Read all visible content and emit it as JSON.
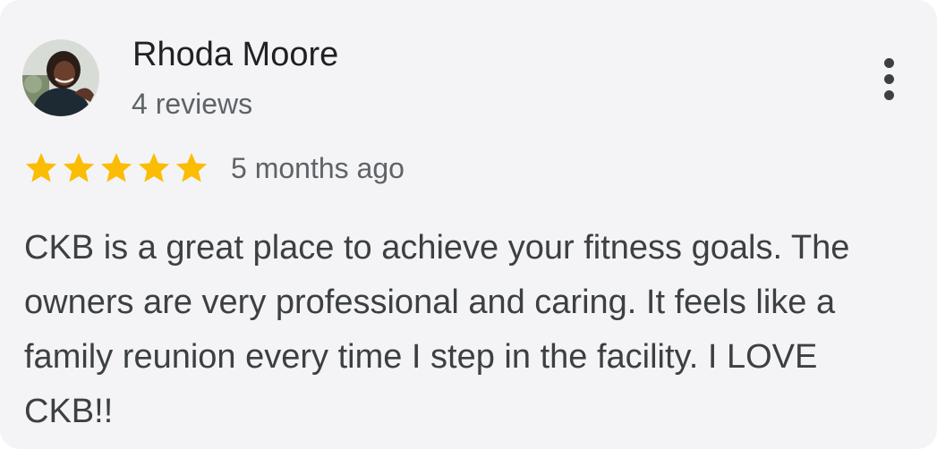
{
  "review": {
    "reviewer_name": "Rhoda Moore",
    "review_count": "4 reviews",
    "rating": 5,
    "rating_max": 5,
    "time_ago": "5 months ago",
    "text": "CKB is a great place to achieve your fitness goals. The owners are very professional and caring. It feels like a family reunion every time I step in the facility. I LOVE CKB!!"
  },
  "icons": {
    "avatar": "avatar",
    "more": "more-vert-icon",
    "star": "star-icon"
  },
  "colors": {
    "card_background": "#f4f4f6",
    "star": "#fbbc04",
    "name_text": "#202124",
    "secondary_text": "#5f6368",
    "body_text": "#3c4043"
  }
}
